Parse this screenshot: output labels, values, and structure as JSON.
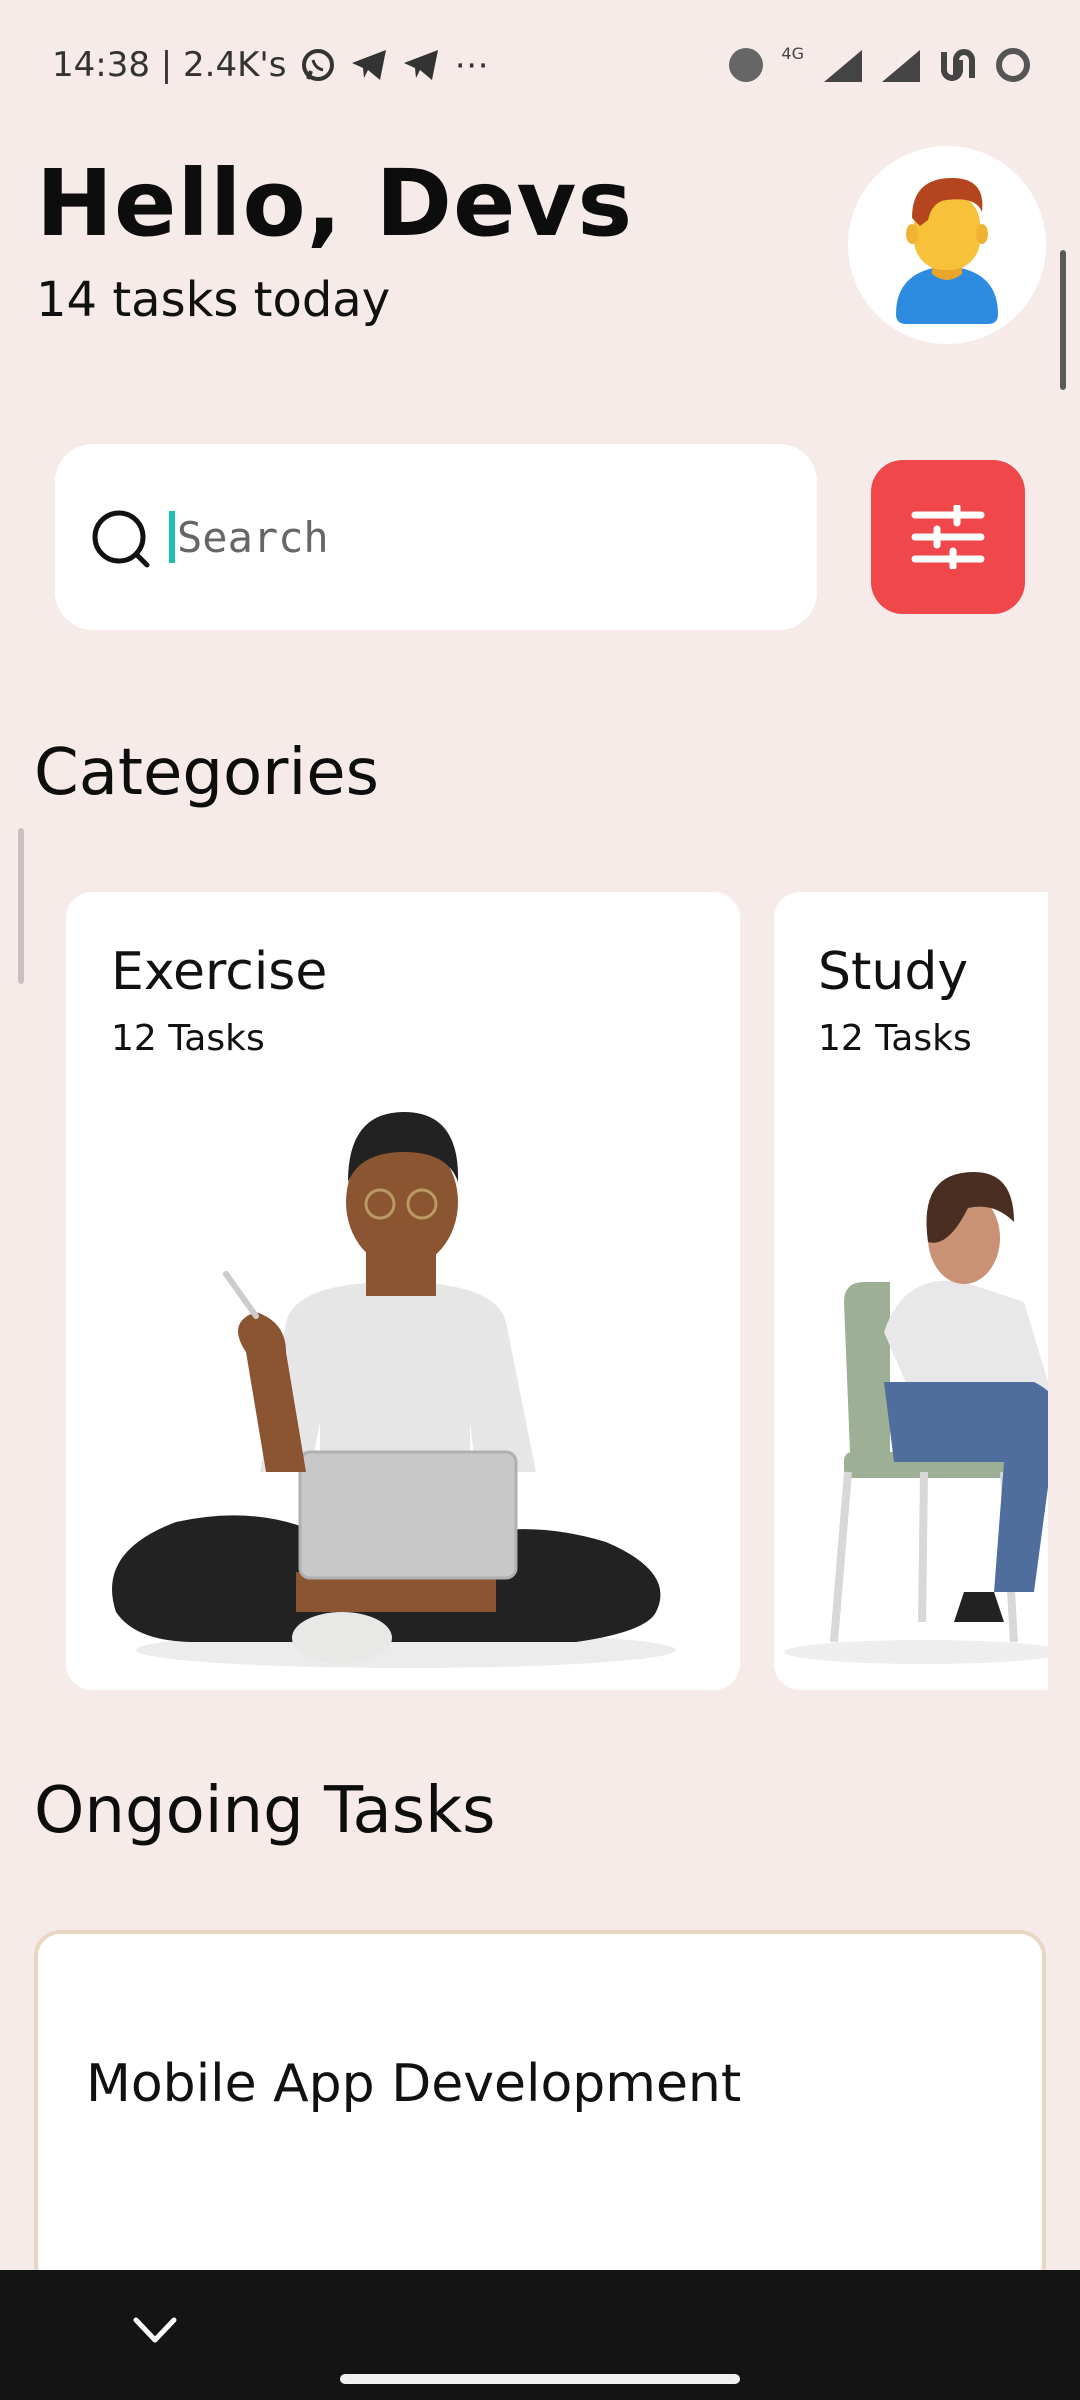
{
  "status_bar": {
    "time_info": "14:38 | 2.4K's",
    "network_label": "4G",
    "icons": [
      "whatsapp-icon",
      "telegram-icon",
      "telegram-icon",
      "more-icon",
      "network-icon",
      "signal-icon",
      "signal-icon",
      "vpn-icon",
      "battery-icon"
    ]
  },
  "header": {
    "greeting": "Hello, Devs",
    "subtitle": "14 tasks today"
  },
  "search": {
    "placeholder": "Search"
  },
  "sections": {
    "categories": "Categories",
    "ongoing": "Ongoing Tasks"
  },
  "categories": [
    {
      "title": "Exercise",
      "tasks": "12 Tasks"
    },
    {
      "title": "Study",
      "tasks": "12 Tasks"
    }
  ],
  "ongoing_tasks": [
    {
      "title": "Mobile App Development"
    }
  ],
  "colors": {
    "background": "#F7EBE9",
    "accent": "#F0474B",
    "caret": "#1FBFB0",
    "ongoing_border": "#E8D6C2"
  }
}
